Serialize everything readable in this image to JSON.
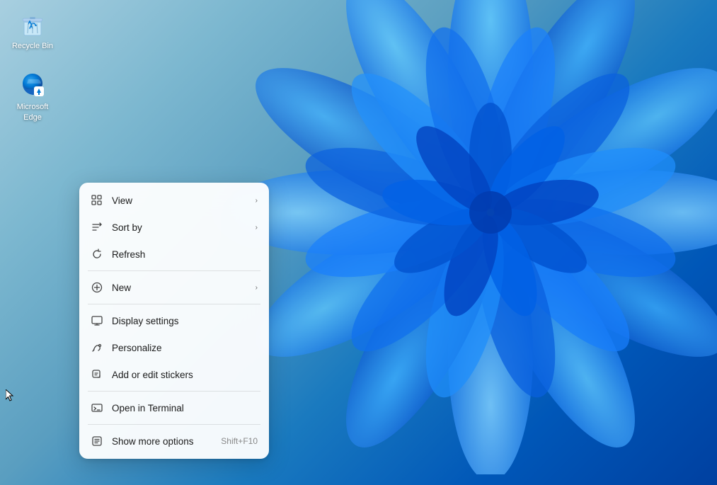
{
  "desktop": {
    "bg_color_start": "#a8cfe0",
    "bg_color_end": "#0040a0"
  },
  "icons": [
    {
      "id": "recycle-bin",
      "label": "Recycle Bin",
      "type": "recycle"
    },
    {
      "id": "microsoft-edge",
      "label": "Microsoft Edge",
      "type": "edge"
    }
  ],
  "context_menu": {
    "items": [
      {
        "id": "view",
        "label": "View",
        "icon": "view",
        "has_arrow": true,
        "has_shortcut": false,
        "shortcut": ""
      },
      {
        "id": "sort-by",
        "label": "Sort by",
        "icon": "sort",
        "has_arrow": true,
        "has_shortcut": false,
        "shortcut": ""
      },
      {
        "id": "refresh",
        "label": "Refresh",
        "icon": "refresh",
        "has_arrow": false,
        "has_shortcut": false,
        "shortcut": ""
      },
      {
        "id": "divider1",
        "type": "divider"
      },
      {
        "id": "new",
        "label": "New",
        "icon": "new",
        "has_arrow": true,
        "has_shortcut": false,
        "shortcut": ""
      },
      {
        "id": "divider2",
        "type": "divider"
      },
      {
        "id": "display-settings",
        "label": "Display settings",
        "icon": "display",
        "has_arrow": false,
        "has_shortcut": false,
        "shortcut": ""
      },
      {
        "id": "personalize",
        "label": "Personalize",
        "icon": "personalize",
        "has_arrow": false,
        "has_shortcut": false,
        "shortcut": ""
      },
      {
        "id": "add-stickers",
        "label": "Add or edit stickers",
        "icon": "stickers",
        "has_arrow": false,
        "has_shortcut": false,
        "shortcut": ""
      },
      {
        "id": "divider3",
        "type": "divider"
      },
      {
        "id": "open-terminal",
        "label": "Open in Terminal",
        "icon": "terminal",
        "has_arrow": false,
        "has_shortcut": false,
        "shortcut": ""
      },
      {
        "id": "divider4",
        "type": "divider"
      },
      {
        "id": "show-more",
        "label": "Show more options",
        "icon": "more",
        "has_arrow": false,
        "has_shortcut": true,
        "shortcut": "Shift+F10"
      }
    ]
  }
}
